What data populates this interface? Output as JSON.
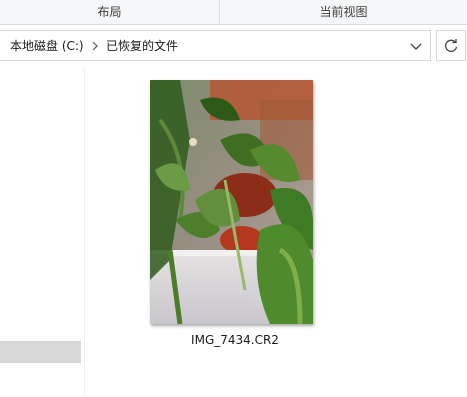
{
  "ribbon": {
    "groups": [
      "布局",
      "当前视图"
    ]
  },
  "address_bar": {
    "breadcrumbs": [
      "本地磁盘 (C:)",
      "已恢复的文件"
    ],
    "separator_icon": "chevron-right-icon",
    "dropdown_icon": "chevron-down-icon",
    "refresh_icon": "refresh-icon"
  },
  "content": {
    "files": [
      {
        "name": "IMG_7434.CR2",
        "thumbnail": "potted-plant-photo"
      }
    ]
  }
}
